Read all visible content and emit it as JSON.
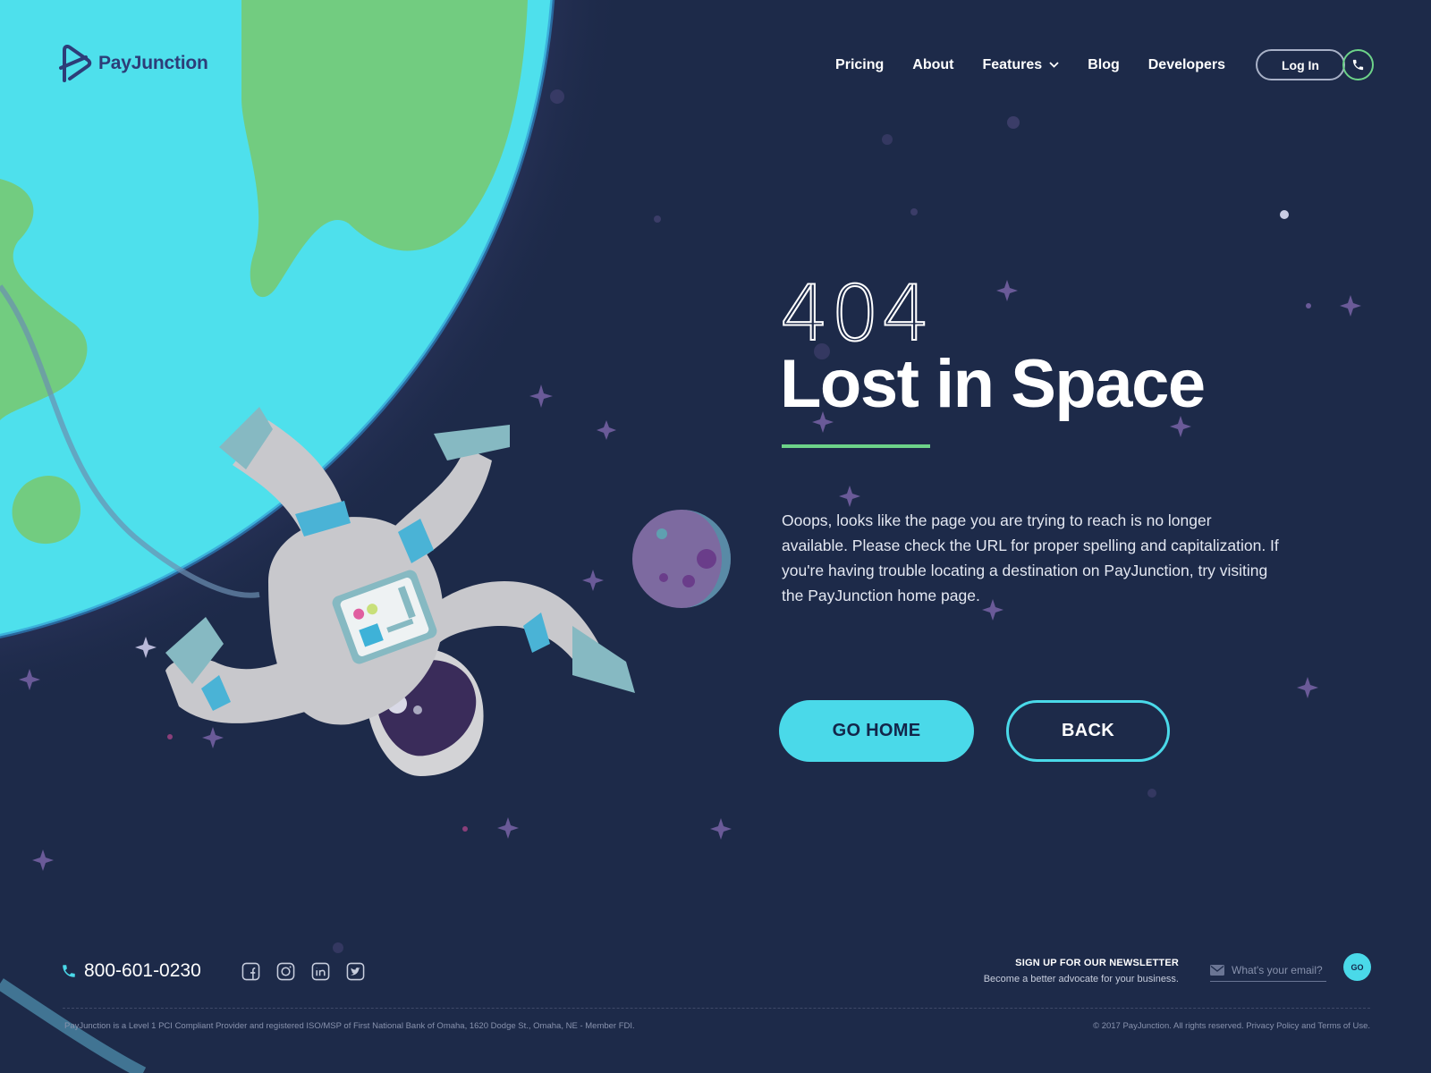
{
  "brand": {
    "name": "PayJunction"
  },
  "nav": {
    "items": [
      {
        "label": "Pricing"
      },
      {
        "label": "About"
      },
      {
        "label": "Features",
        "has_dropdown": true
      },
      {
        "label": "Blog"
      },
      {
        "label": "Developers"
      }
    ],
    "login_label": "Log In",
    "phone_icon": "phone-icon"
  },
  "hero": {
    "code": "404",
    "title": "Lost in Space",
    "message": "Ooops, looks like the page you are trying to reach is no longer available. Please check the URL for proper spelling and capitalization. If you're having trouble locating a destination on PayJunction, try visiting the PayJunction home page.",
    "go_home_label": "GO HOME",
    "back_label": "BACK"
  },
  "footer": {
    "phone": "800-601-0230",
    "socials": [
      "facebook-icon",
      "instagram-icon",
      "linkedin-icon",
      "twitter-icon"
    ],
    "newsletter": {
      "title": "SIGN UP FOR OUR NEWSLETTER",
      "subtitle": "Become a better advocate for your business.",
      "placeholder": "What's your email?",
      "go_label": "GO"
    },
    "legal_left": "PayJunction is a Level 1 PCI Compliant Provider and registered ISO/MSP of First National Bank of Omaha, 1620 Dodge St., Omaha, NE - Member FDI.",
    "legal_right_prefix": "© 2017 PayJunction. All rights reserved.",
    "privacy_label": "Privacy Policy",
    "and_label": "and",
    "terms_label": "Terms of Use."
  },
  "colors": {
    "background": "#1d2a49",
    "accent_cyan": "#4ad9e9",
    "accent_green": "#6dd389",
    "planet_ocean": "#4ee0ec",
    "planet_land": "#72cc80",
    "brand_navy": "#2d3d78"
  }
}
